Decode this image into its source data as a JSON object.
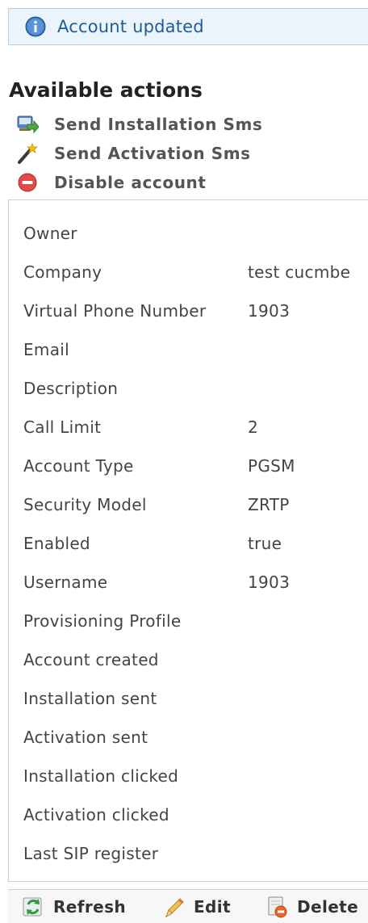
{
  "notice": {
    "text": "Account updated",
    "icon": "info-icon"
  },
  "actions": {
    "title": "Available actions",
    "items": [
      {
        "label": "Send Installation Sms",
        "icon": "sms-install-icon"
      },
      {
        "label": "Send Activation Sms",
        "icon": "magic-wand-icon"
      },
      {
        "label": "Disable account",
        "icon": "disable-icon"
      }
    ]
  },
  "details": [
    {
      "key": "Owner",
      "value": ""
    },
    {
      "key": "Company",
      "value": "test cucmbe"
    },
    {
      "key": "Virtual Phone Number",
      "value": "1903"
    },
    {
      "key": "Email",
      "value": ""
    },
    {
      "key": "Description",
      "value": ""
    },
    {
      "key": "Call Limit",
      "value": "2"
    },
    {
      "key": "Account Type",
      "value": "PGSM"
    },
    {
      "key": "Security Model",
      "value": "ZRTP"
    },
    {
      "key": "Enabled",
      "value": "true"
    },
    {
      "key": "Username",
      "value": "1903"
    },
    {
      "key": "Provisioning Profile",
      "value": ""
    },
    {
      "key": "Account created",
      "value": ""
    },
    {
      "key": "Installation sent",
      "value": ""
    },
    {
      "key": "Activation sent",
      "value": ""
    },
    {
      "key": "Installation clicked",
      "value": ""
    },
    {
      "key": "Activation clicked",
      "value": ""
    },
    {
      "key": "Last SIP register",
      "value": ""
    }
  ],
  "toolbar": {
    "refresh_label": "Refresh",
    "edit_label": "Edit",
    "delete_label": "Delete"
  }
}
